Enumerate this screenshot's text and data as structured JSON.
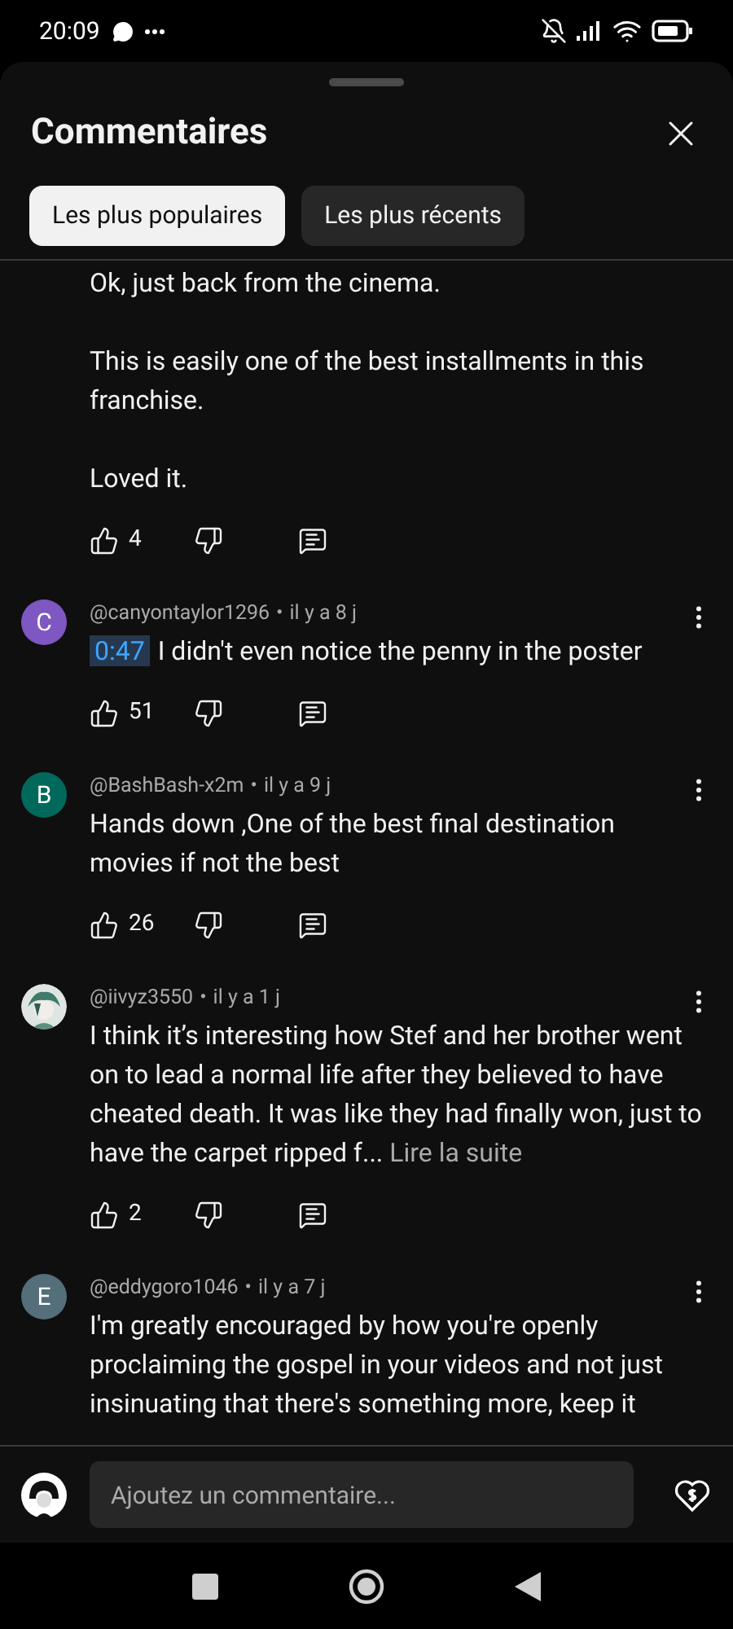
{
  "status_bar": {
    "time": "20:09"
  },
  "sheet": {
    "title": "Commentaires"
  },
  "tabs": [
    {
      "label": "Les plus populaires",
      "selected": true
    },
    {
      "label": "Les plus récents",
      "selected": false
    }
  ],
  "comments": [
    {
      "kind": "partial",
      "text": "Ok, just back from the cinema.\n\nThis is easily one of the best installments in this franchise.\n\nLoved it.",
      "likes": "4"
    },
    {
      "kind": "full",
      "avatar": {
        "kind": "letter",
        "letter": "C",
        "color": "#7e57c2"
      },
      "author": "@canyontaylor1296",
      "separator": "•",
      "age": "il y a 8 j",
      "timestamp": "0:47",
      "text": "I didn't even notice the penny in the poster",
      "likes": "51"
    },
    {
      "kind": "full",
      "avatar": {
        "kind": "letter",
        "letter": "B",
        "color": "#00695c"
      },
      "author": "@BashBash-x2m",
      "separator": "•",
      "age": "il y a 9 j",
      "text": "Hands down ,One of the best  final destination movies if not the best",
      "likes": "26"
    },
    {
      "kind": "full",
      "author": "@iivyz3550",
      "separator": "•",
      "age": "il y a 1 j",
      "text": "I think it’s interesting how Stef and her brother went on to lead a normal life after they believed to have cheated death. It was like they had finally won, just to have the carpet ripped f...",
      "more_link": "Lire la suite",
      "likes": "2"
    },
    {
      "kind": "full",
      "avatar": {
        "kind": "letter",
        "letter": "E",
        "color": "#546e7a"
      },
      "author": "@eddygoro1046",
      "separator": "•",
      "age": "il y a 7 j",
      "text": "I'm greatly encouraged by how you're openly proclaiming the gospel in your videos and not just insinuating that there's something more, keep it"
    }
  ],
  "composer": {
    "placeholder": "Ajoutez un commentaire..."
  }
}
